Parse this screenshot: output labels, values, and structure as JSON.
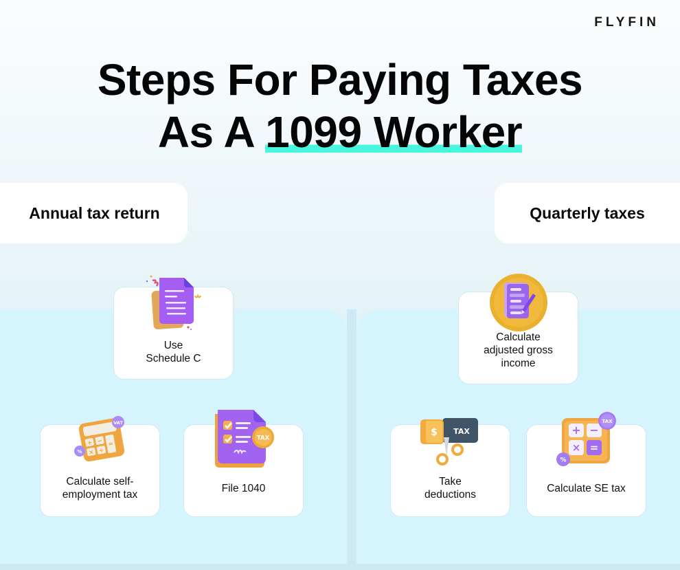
{
  "brand": {
    "logo": "FLYFIN"
  },
  "header": {
    "title_line1": "Steps For Paying Taxes",
    "title_line2_prefix": "As A ",
    "title_line2_highlight": "1099 Worker",
    "highlight_color": "#48f6dd"
  },
  "sections": {
    "annual": {
      "label": "Annual tax return",
      "steps": [
        {
          "label_line1": "Use",
          "label_line2": "Schedule C",
          "icon": "document-icon"
        },
        {
          "label_line1": "Calculate self-",
          "label_line2": "employment tax",
          "icon": "calculator-vat-icon"
        },
        {
          "label_line1": "File 1040",
          "label_line2": "",
          "icon": "tax-form-checklist-icon"
        }
      ]
    },
    "quarterly": {
      "label": "Quarterly taxes",
      "steps": [
        {
          "label_line1": "Calculate",
          "label_line2": "adjusted gross",
          "label_line3": "income",
          "icon": "document-pen-coin-icon"
        },
        {
          "label_line1": "Take",
          "label_line2": "deductions",
          "icon": "scissors-tax-icon"
        },
        {
          "label_line1": "Calculate SE tax",
          "label_line2": "",
          "icon": "calculator-tax-icon"
        }
      ]
    }
  },
  "colors": {
    "panel": "#d6f4fd",
    "card": "#ffffff",
    "icon_purple": "#9b5cf0",
    "icon_orange": "#f2a93b"
  }
}
